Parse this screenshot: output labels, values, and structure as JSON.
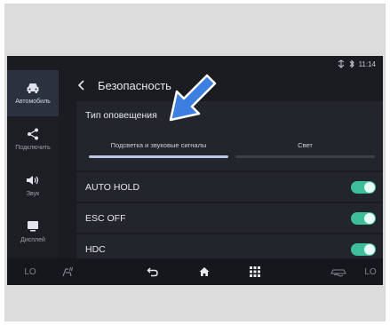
{
  "status": {
    "time": "11:14",
    "icons": [
      "signal-icon",
      "bluetooth-icon"
    ]
  },
  "sidebar": {
    "items": [
      {
        "label": "Автомобиль",
        "icon": "car-icon",
        "active": true
      },
      {
        "label": "Подключить",
        "icon": "share-icon",
        "active": false
      },
      {
        "label": "Звук",
        "icon": "speaker-icon",
        "active": false
      },
      {
        "label": "Дисплей",
        "icon": "display-icon",
        "active": false
      }
    ]
  },
  "header": {
    "title": "Безопасность"
  },
  "alert_type": {
    "label": "Тип оповещения",
    "options": [
      {
        "label": "Подсветка и звуковые сигналы",
        "selected": true
      },
      {
        "label": "Свет",
        "selected": false
      }
    ]
  },
  "toggles": [
    {
      "label": "AUTO HOLD",
      "on": true
    },
    {
      "label": "ESC OFF",
      "on": true
    },
    {
      "label": "HDC",
      "on": true
    }
  ],
  "bottom": {
    "left_temp": "LO",
    "right_temp": "LO"
  },
  "colors": {
    "accent_toggle": "#3fbe9c",
    "selected_tab": "#b9c9e3",
    "annotation_arrow": "#3d7fe0"
  }
}
